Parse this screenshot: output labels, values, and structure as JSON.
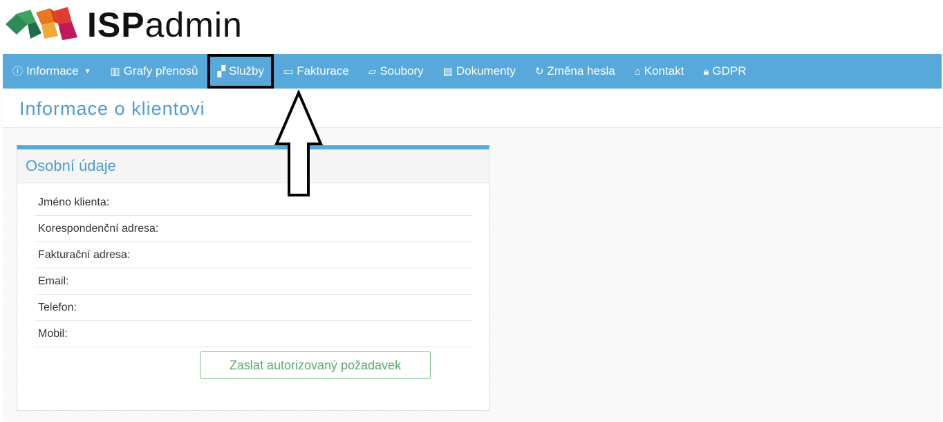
{
  "header": {
    "logo_bold": "ISP",
    "logo_light": "admin"
  },
  "nav": {
    "items": [
      {
        "label": "Informace",
        "icon": "info-circle-icon"
      },
      {
        "label": "Grafy přenosů",
        "icon": "bar-chart-icon"
      },
      {
        "label": "Služby",
        "icon": "sitemap-icon"
      },
      {
        "label": "Fakturace",
        "icon": "money-icon"
      },
      {
        "label": "Soubory",
        "icon": "folder-open-icon"
      },
      {
        "label": "Dokumenty",
        "icon": "document-icon"
      },
      {
        "label": "Změna hesla",
        "icon": "refresh-icon"
      },
      {
        "label": "Kontakt",
        "icon": "home-icon"
      },
      {
        "label": "GDPR",
        "icon": "lock-icon"
      }
    ]
  },
  "page": {
    "title": "Informace o klientovi"
  },
  "panel": {
    "title": "Osobní údaje",
    "rows": [
      {
        "label": "Jméno klienta:"
      },
      {
        "label": "Korespondenční adresa:"
      },
      {
        "label": "Fakturační adresa:"
      },
      {
        "label": "Email:"
      },
      {
        "label": "Telefon:"
      },
      {
        "label": "Mobil:"
      }
    ],
    "button_label": "Zaslat autorizovaný požadavek"
  },
  "colors": {
    "brand_blue": "#57a8db",
    "title_blue": "#4f9ccf",
    "button_green": "#5aab6b"
  }
}
